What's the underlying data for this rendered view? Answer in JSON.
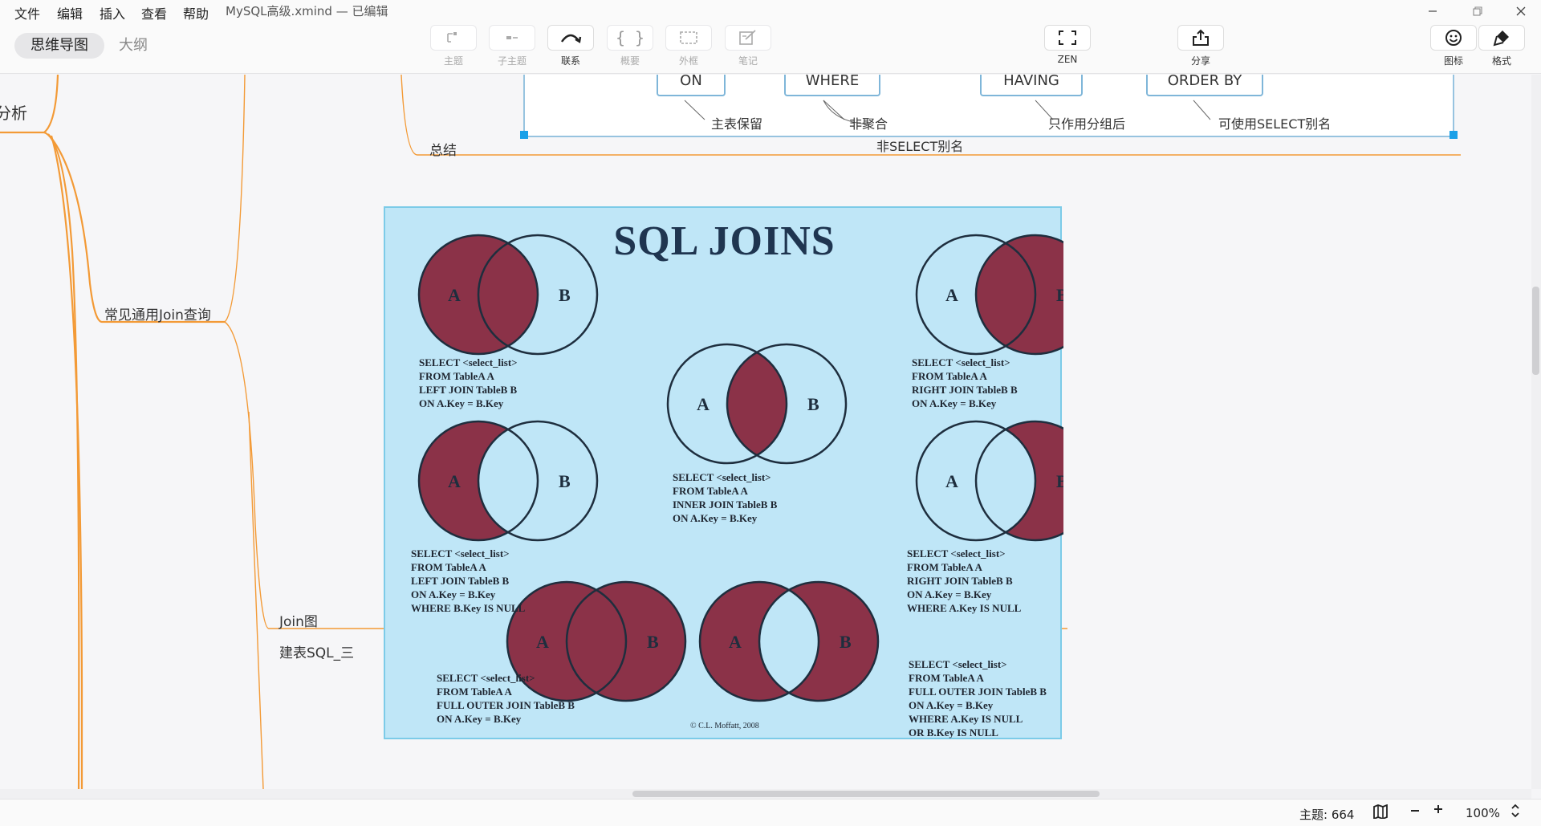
{
  "menu": {
    "items": [
      "文件",
      "编辑",
      "插入",
      "查看",
      "帮助"
    ],
    "doc_title": "MySQL高级.xmind — 已编辑"
  },
  "toolbar": {
    "mode_mindmap": "思维导图",
    "mode_outline": "大纲",
    "topic": "主题",
    "subtopic": "子主题",
    "relation": "联系",
    "summary": "概要",
    "boundary": "外框",
    "note": "笔记",
    "zen": "ZEN",
    "share": "分享",
    "icons": "图标",
    "format": "格式"
  },
  "mindmap": {
    "left_partial": "分析",
    "branch_join": "常见通用Join查询",
    "summary_label": "总结",
    "join_diagram_label": "Join图",
    "bottom_partial": "建表SQL_三",
    "keywords": [
      "ON",
      "WHERE",
      "HAVING",
      "ORDER BY"
    ],
    "notes": [
      "主表保留",
      "非聚合",
      "非SELECT别名",
      "只作用分组后",
      "可使用SELECT别名"
    ]
  },
  "sql_joins": {
    "title": "SQL JOINS",
    "left_join": "SELECT <select_list>\nFROM TableA A\nLEFT JOIN TableB B\nON A.Key = B.Key",
    "right_join": "SELECT <select_list>\nFROM TableA A\nRIGHT JOIN TableB B\nON A.Key = B.Key",
    "inner_join": "SELECT <select_list>\nFROM TableA A\nINNER JOIN TableB B\nON A.Key = B.Key",
    "left_excl": "SELECT <select_list>\nFROM TableA A\nLEFT JOIN TableB B\nON A.Key = B.Key\nWHERE B.Key IS NULL",
    "right_excl": "SELECT <select_list>\nFROM TableA A\nRIGHT JOIN TableB B\nON A.Key = B.Key\nWHERE A.Key IS NULL",
    "full_outer": "SELECT <select_list>\nFROM TableA A\nFULL OUTER JOIN TableB B\nON A.Key = B.Key",
    "full_outer_excl": "SELECT <select_list>\nFROM TableA A\nFULL OUTER JOIN TableB B\nON A.Key = B.Key\nWHERE A.Key IS NULL\nOR B.Key IS NULL",
    "label_a": "A",
    "label_b": "B",
    "credit": "© C.L. Moffatt, 2008",
    "fill_color": "#8b3248",
    "bg_color": "#bfe6f7"
  },
  "status": {
    "topics": "主题: 664",
    "zoom": "100%"
  },
  "colors": {
    "branch": "#f39a36",
    "boundary": "#7fb6d9",
    "selection": "#1aa0e8"
  }
}
